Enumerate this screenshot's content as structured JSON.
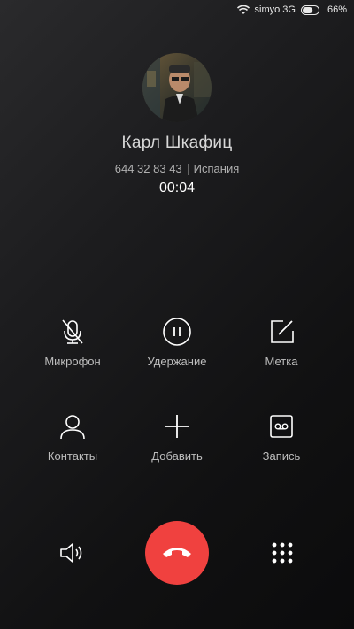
{
  "status_bar": {
    "carrier": "simyo 3G",
    "battery_percent": "66%",
    "battery_level": 0.66
  },
  "contact": {
    "name": "Карл Шкафиц",
    "phone": "644 32 83 43",
    "location": "Испания",
    "timer": "00:04"
  },
  "actions": {
    "mute": "Микрофон",
    "hold": "Удержание",
    "note": "Метка",
    "contacts": "Контакты",
    "add": "Добавить",
    "record": "Запись"
  },
  "icons": {
    "speaker": "speaker-icon",
    "end_call": "end-call-icon",
    "dialpad": "dialpad-icon"
  },
  "colors": {
    "end_call": "#f0413f"
  }
}
